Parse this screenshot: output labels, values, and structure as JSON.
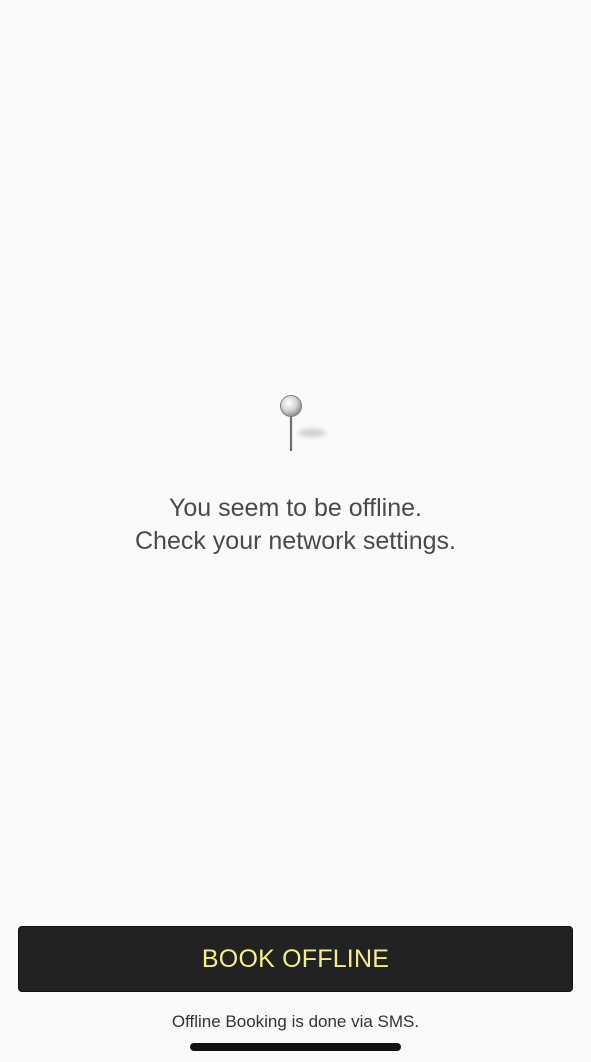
{
  "offline": {
    "icon": "map-pin-icon",
    "line1": "You seem to be offline.",
    "line2": "Check your network settings."
  },
  "actions": {
    "book_offline_label": "BOOK OFFLINE",
    "note": "Offline Booking is done via SMS."
  },
  "colors": {
    "background": "#fafafa",
    "button_bg": "#222222",
    "button_text": "#f5ef8b",
    "message_text": "#4a4a4a"
  }
}
